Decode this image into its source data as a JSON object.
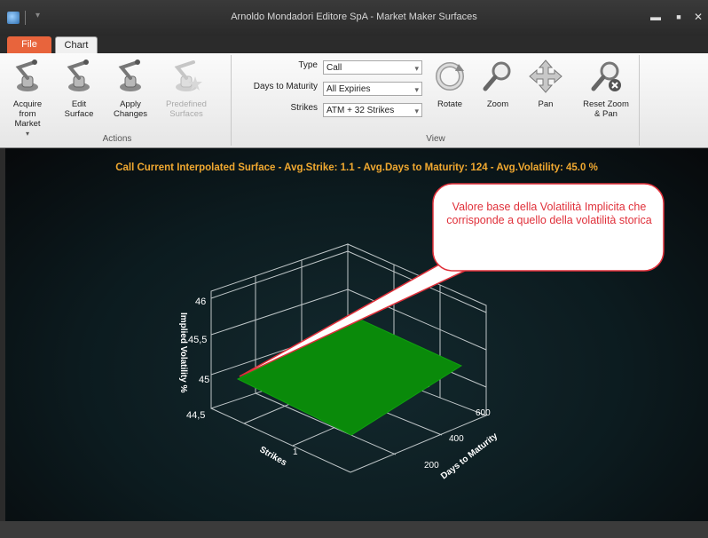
{
  "window": {
    "title": "Arnoldo Mondadori Editore SpA - Market Maker Surfaces",
    "minimize_glyph": "▬",
    "maximize_glyph": "■",
    "close_glyph": "✕"
  },
  "tabs": {
    "file": "File",
    "chart": "Chart"
  },
  "ribbon": {
    "actions": {
      "group_label": "Actions",
      "acquire": "Acquire from Market",
      "edit": "Edit Surface",
      "apply": "Apply Changes",
      "predefined": "Predefined Surfaces"
    },
    "view": {
      "group_label": "View",
      "type_label": "Type",
      "type_value": "Call",
      "days_label": "Days to Maturity",
      "days_value": "All Expiries",
      "strikes_label": "Strikes",
      "strikes_value": "ATM + 32 Strikes",
      "rotate": "Rotate",
      "zoom": "Zoom",
      "pan": "Pan",
      "reset": "Reset Zoom & Pan"
    }
  },
  "chart": {
    "header": "Call Current Interpolated Surface  -  Avg.Strike:  1.1  -  Avg.Days to Maturity:  124  -  Avg.Volatility:  45.0 %",
    "callout": "Valore base della Volatilità Implicita che corrisponde a quello della volatilità storica",
    "accent_color": "#f0a830",
    "surface_color": "#0a8a0a",
    "callout_color": "#e0303a"
  },
  "chart_data": {
    "type": "surface",
    "title": "Call Current Interpolated Surface",
    "zlabel": "Implied Volatility %",
    "xlabel": "Strikes",
    "ylabel": "Days to Maturity",
    "z_ticks": [
      "44,5",
      "45",
      "45,5",
      "46"
    ],
    "y_ticks": [
      "200",
      "400",
      "600"
    ],
    "x_ticks": [
      "1"
    ],
    "zlim": [
      44.5,
      46
    ],
    "surface_z": 45.0
  }
}
